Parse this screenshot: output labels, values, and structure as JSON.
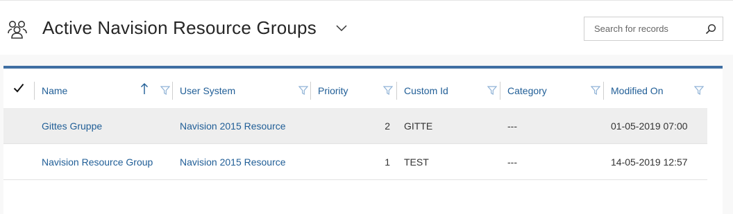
{
  "header": {
    "entity_icon": "people-group-icon",
    "title": "Active Navision Resource Groups",
    "view_selector_icon": "chevron-down-icon"
  },
  "search": {
    "placeholder": "Search for records",
    "icon": "search-icon"
  },
  "grid": {
    "select_all_icon": "checkmark-icon",
    "columns": [
      {
        "key": "name",
        "label": "Name",
        "sorted": "ascending"
      },
      {
        "key": "user_system",
        "label": "User System"
      },
      {
        "key": "priority",
        "label": "Priority"
      },
      {
        "key": "custom_id",
        "label": "Custom Id"
      },
      {
        "key": "category",
        "label": "Category"
      },
      {
        "key": "modified_on",
        "label": "Modified On"
      }
    ],
    "rows": [
      {
        "name": "Gittes Gruppe",
        "user_system": "Navision 2015 Resource",
        "priority": "2",
        "custom_id": "GITTE",
        "category": "---",
        "modified_on": "01-05-2019 07:00",
        "selected": true
      },
      {
        "name": "Navision Resource Group",
        "user_system": "Navision 2015 Resource",
        "priority": "1",
        "custom_id": "TEST",
        "category": "---",
        "modified_on": "14-05-2019 12:57",
        "selected": false
      }
    ]
  },
  "colors": {
    "accent": "#3f6fa3",
    "link": "#1f5d96",
    "selected_row": "#eeeeee"
  }
}
